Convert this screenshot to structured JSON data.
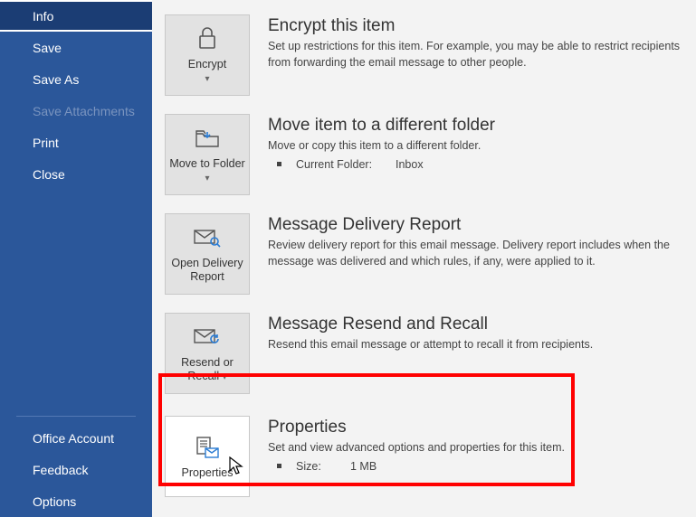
{
  "sidebar": {
    "items": [
      {
        "label": "Info"
      },
      {
        "label": "Save"
      },
      {
        "label": "Save As"
      },
      {
        "label": "Save Attachments"
      },
      {
        "label": "Print"
      },
      {
        "label": "Close"
      }
    ],
    "bottom": [
      {
        "label": "Office Account"
      },
      {
        "label": "Feedback"
      },
      {
        "label": "Options"
      }
    ]
  },
  "sections": {
    "encrypt": {
      "tile": "Encrypt",
      "title": "Encrypt this item",
      "desc": "Set up restrictions for this item. For example, you may be able to restrict recipients from forwarding the email message to other people."
    },
    "move": {
      "tile": "Move to Folder",
      "title": "Move item to a different folder",
      "desc": "Move or copy this item to a different folder.",
      "prop_key": "Current Folder:",
      "prop_val": "Inbox"
    },
    "delivery": {
      "tile": "Open Delivery Report",
      "title": "Message Delivery Report",
      "desc": "Review delivery report for this email message. Delivery report includes when the message was delivered and which rules, if any, were applied to it."
    },
    "resend": {
      "tile": "Resend or Recall",
      "title": "Message Resend and Recall",
      "desc": "Resend this email message or attempt to recall it from recipients."
    },
    "properties": {
      "tile": "Properties",
      "title": "Properties",
      "desc": "Set and view advanced options and properties for this item.",
      "prop_key": "Size:",
      "prop_val": "1 MB"
    }
  }
}
